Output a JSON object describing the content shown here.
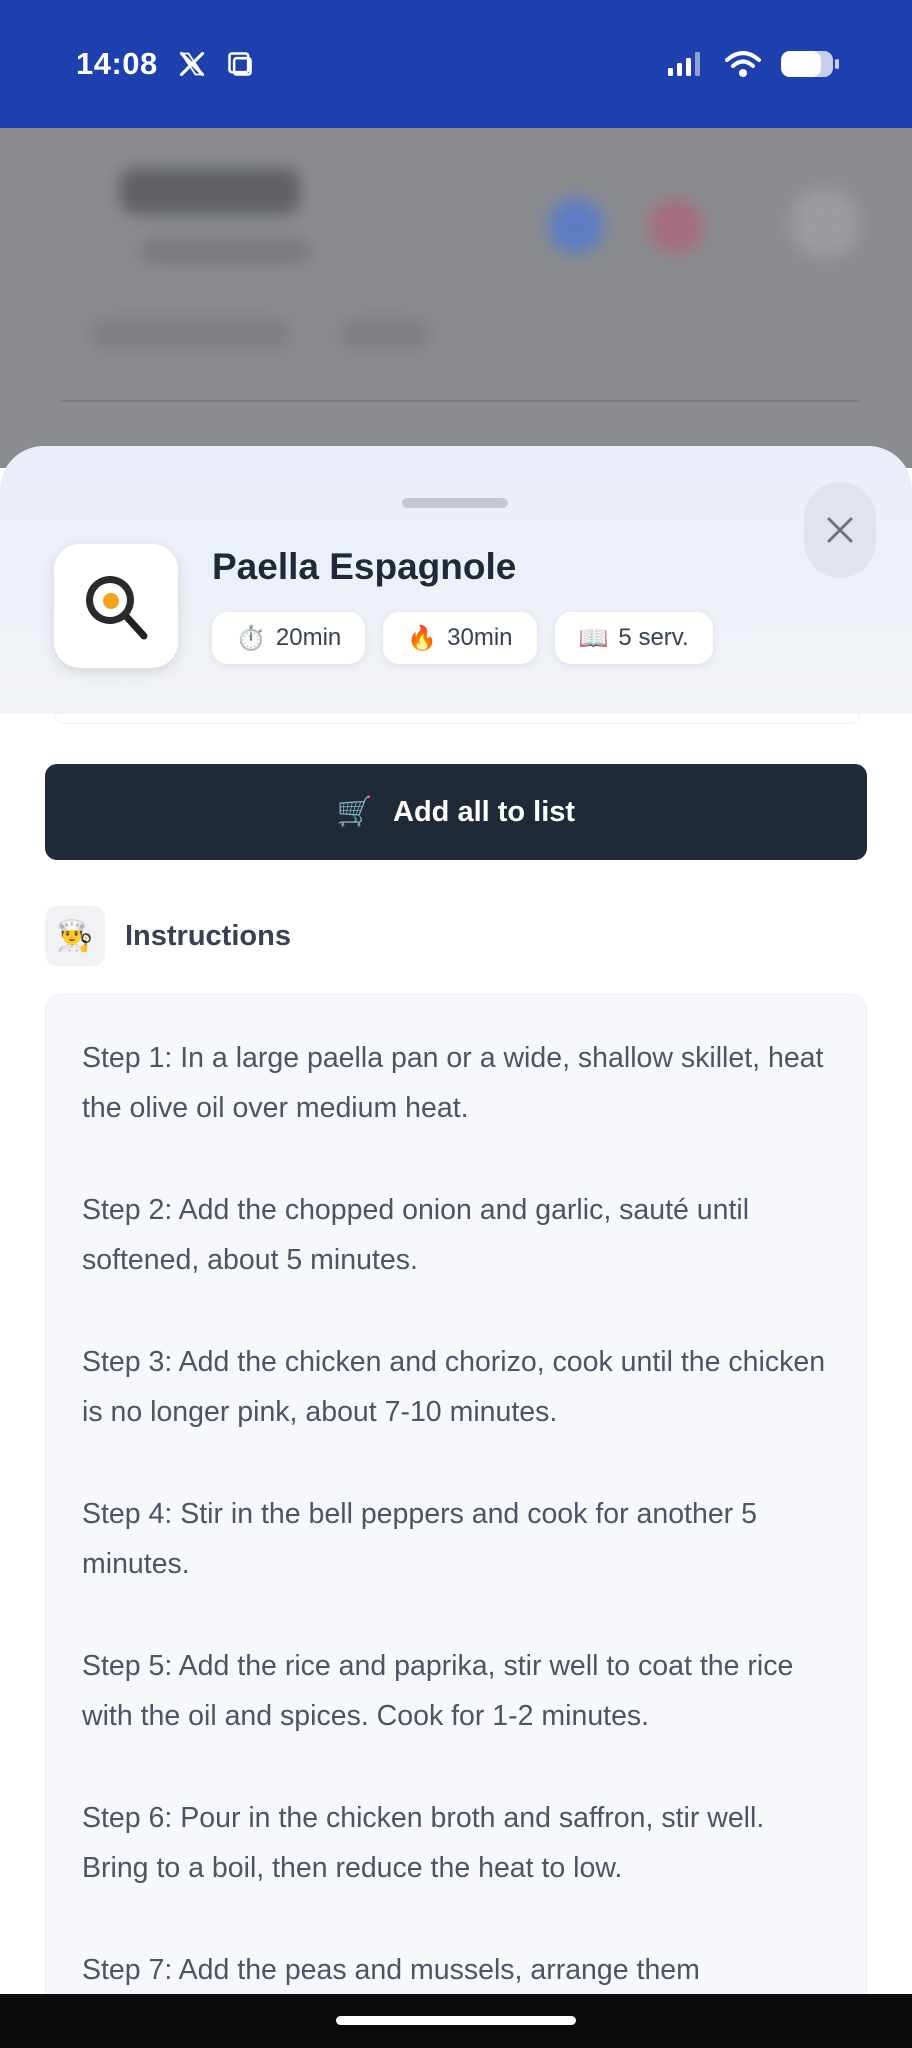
{
  "status_bar": {
    "time": "14:08",
    "icons": [
      "x-logo-icon",
      "screen-icon",
      "signal-icon",
      "wifi-icon",
      "battery-icon"
    ]
  },
  "recipe": {
    "title": "Paella Espagnole",
    "icon": "frying-pan-egg-icon",
    "chips": [
      {
        "emoji": "⏱️",
        "label": "20min",
        "icon": "timer-icon"
      },
      {
        "emoji": "🔥",
        "label": "30min",
        "icon": "fire-icon"
      },
      {
        "emoji": "📖",
        "label": "5 serv.",
        "icon": "book-icon"
      }
    ]
  },
  "actions": {
    "add_all_emoji": "🛒",
    "add_all_label": "Add all to list"
  },
  "instructions": {
    "emoji": "👨‍🍳",
    "title": "Instructions",
    "steps": [
      "Step 1: In a large paella pan or a wide, shallow skillet, heat the olive oil over medium heat.",
      "Step 2: Add the chopped onion and garlic, sauté until softened, about 5 minutes.",
      "Step 3: Add the chicken and chorizo, cook until the chicken is no longer pink, about 7-10 minutes.",
      "Step 4: Stir in the bell peppers and cook for another 5 minutes.",
      "Step 5: Add the rice and paprika, stir well to coat the rice with the oil and spices. Cook for 1-2 minutes.",
      "Step 6: Pour in the chicken broth and saffron, stir well. Bring to a boil, then reduce the heat to low.",
      "Step 7: Add the peas and mussels, arrange them"
    ]
  },
  "colors": {
    "status_bar": "#1e40af",
    "primary_button": "#1f2937",
    "text_dark": "#1f2937",
    "text_body": "#4b5563"
  }
}
